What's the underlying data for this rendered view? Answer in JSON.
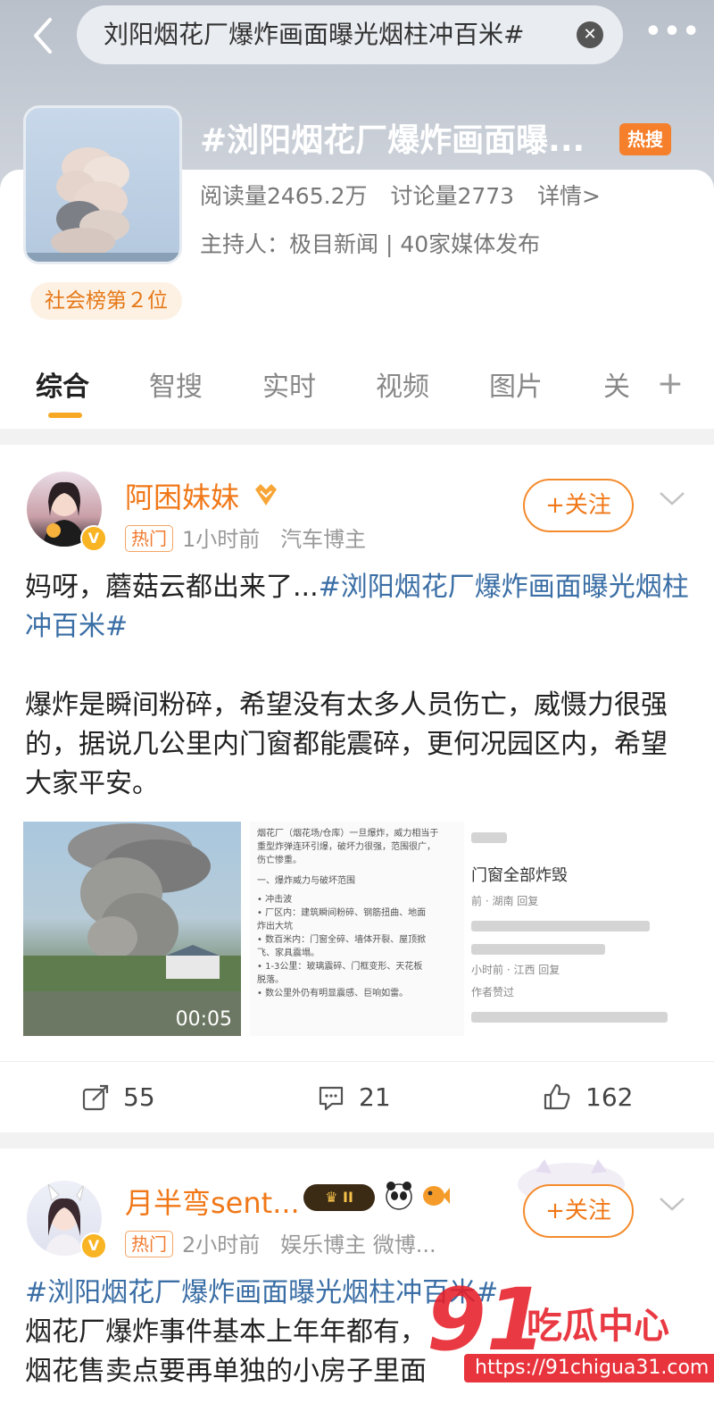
{
  "header": {
    "search_text": "刘阳烟花厂爆炸画面曝光烟柱冲百米#",
    "back_icon": "chevron-left-icon",
    "clear_icon": "close-circle-icon",
    "more_icon": "more-horizontal-icon"
  },
  "topic": {
    "title": "#浏阳烟花厂爆炸画面曝...",
    "hot_badge": "热搜",
    "reads": "阅读量2465.2万",
    "discussions": "讨论量2773",
    "details": "详情>",
    "host": "主持人：极目新闻 | 40家媒体发布",
    "rank": "社会榜第２位"
  },
  "tabs": [
    {
      "label": "综合",
      "active": true
    },
    {
      "label": "智搜",
      "active": false
    },
    {
      "label": "实时",
      "active": false
    },
    {
      "label": "视频",
      "active": false
    },
    {
      "label": "图片",
      "active": false
    },
    {
      "label": "关",
      "active": false
    }
  ],
  "tab_add_label": "+",
  "posts": [
    {
      "author": "阿困妹妹",
      "hot_tag": "热门",
      "time": "1小时前",
      "role": "汽车博主",
      "follow_label": "+关注",
      "text_plain": "妈呀，蘑菇云都出来了...",
      "text_link": "#浏阳烟花厂爆炸画面曝光烟柱冲百米#",
      "text_body": "爆炸是瞬间粉碎，希望没有太多人员伤亡，威慑力很强的，据说几公里内门窗都能震碎，更何况园区内，希望大家平安。",
      "video_duration": "00:05",
      "doc_lines": [
        "烟花厂（烟花场/仓库）一旦爆炸，威力相当于",
        "重型炸弹连环引爆，破坏力很强，范围很广，",
        "伤亡惨重。",
        "一、爆炸威力与破坏范围",
        "• 冲击波",
        "• 厂区内：建筑瞬间粉碎、钢筋扭曲、地面",
        "  炸出大坑",
        "• 数百米内：门窗全碎、墙体开裂、屋顶掀",
        "  飞、家具震塌。",
        "• 1-3公里：玻璃震碎、门框变形、天花板",
        "  脱落。",
        "• 数公里外仍有明显震感、巨响如雷。"
      ],
      "chat_main": "门窗全部炸毁",
      "chat_meta_1": "前 · 湖南    回复",
      "chat_meta_2": "小时前 · 江西    回复",
      "chat_meta_3": "作者赞过",
      "reposts": "55",
      "comments": "21",
      "likes": "162"
    },
    {
      "author": "月半弯sent...",
      "level_badge": "II",
      "hot_tag": "热门",
      "time": "2小时前",
      "role": "娱乐博主 微博...",
      "follow_label": "+关注",
      "text_link": "#浏阳烟花厂爆炸画面曝光烟柱冲百米#",
      "text_line_1": "烟花厂爆炸事件基本上年年都有，",
      "text_line_2": "烟花售卖点要再单独的小房子里面"
    }
  ],
  "watermark": {
    "number": "91",
    "text": "吃瓜中心",
    "url": "https://91chigua31.com"
  },
  "colors": {
    "accent": "#f07818",
    "link": "#3a6ea5",
    "tab_indicator": "#f7a823",
    "hot_badge": "#f57f2b"
  }
}
